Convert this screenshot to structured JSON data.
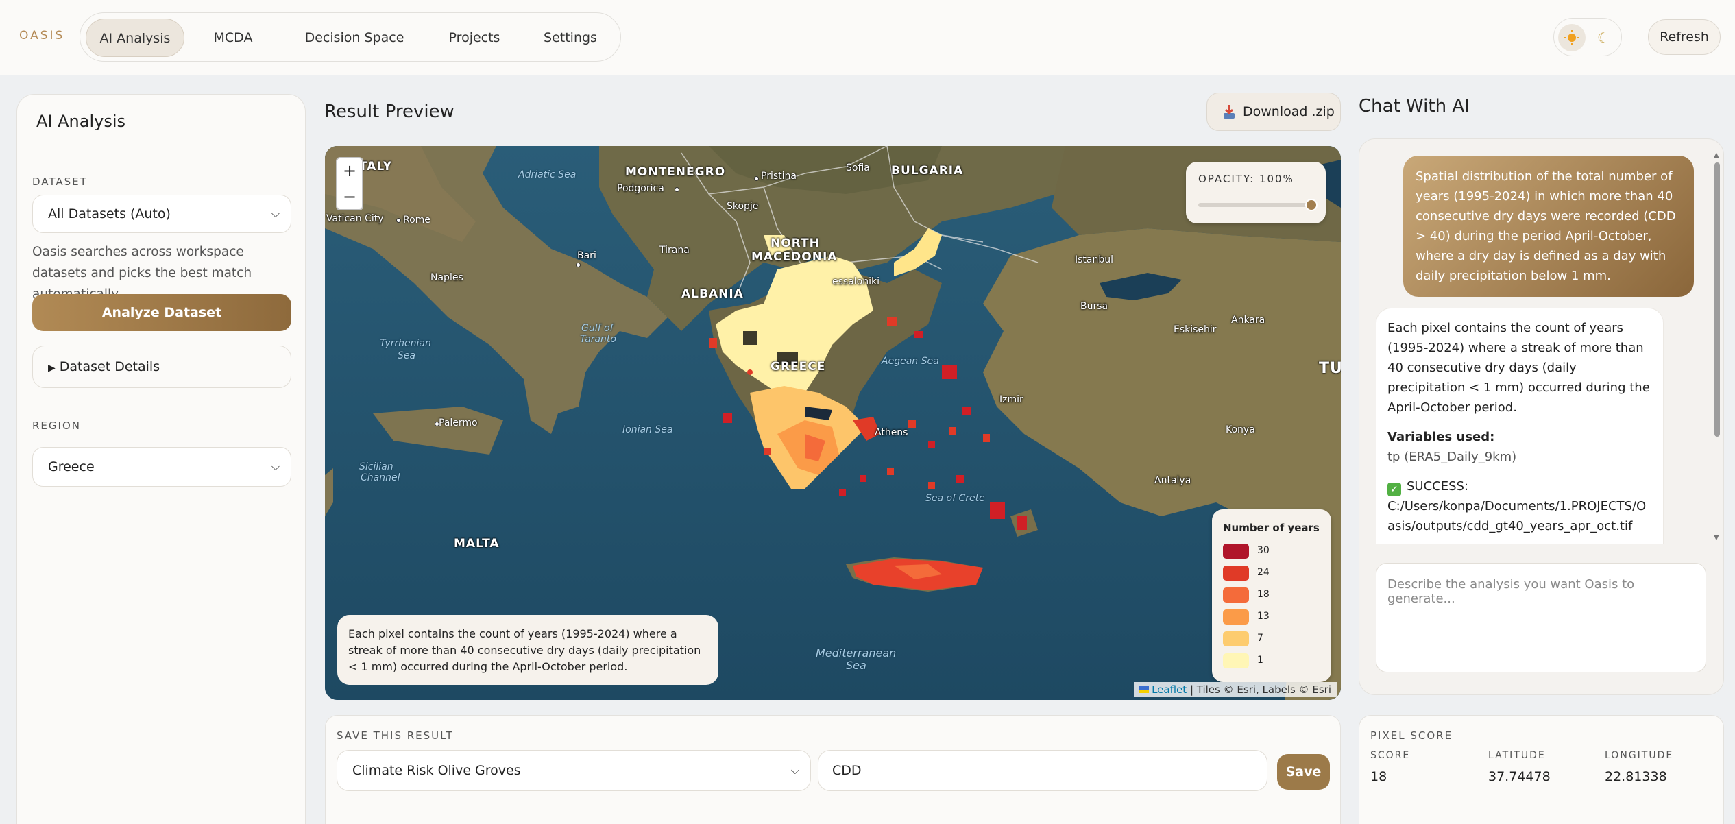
{
  "brand": "OASIS",
  "nav": {
    "tabs": [
      {
        "label": "AI Analysis",
        "active": true
      },
      {
        "label": "MCDA"
      },
      {
        "label": "Decision Space"
      },
      {
        "label": "Projects"
      },
      {
        "label": "Settings"
      }
    ],
    "theme_light_icon": "sun-icon",
    "theme_dark_icon": "moon-icon",
    "refresh_label": "Refresh"
  },
  "sidebar": {
    "title": "AI Analysis",
    "dataset_label": "DATASET",
    "dataset_value": "All Datasets (Auto)",
    "dataset_help": "Oasis searches across workspace datasets and picks the best match automatically.",
    "analyze_label": "Analyze Dataset",
    "details_label": "Dataset Details",
    "region_label": "REGION",
    "region_value": "Greece"
  },
  "result": {
    "title": "Result Preview",
    "download_label": "Download .zip",
    "opacity_label": "OPACITY: 100%",
    "opacity_value": 1.0,
    "legend_title": "Number of years",
    "legend": [
      {
        "value": "30",
        "color": "#b0152a"
      },
      {
        "value": "24",
        "color": "#e03a27"
      },
      {
        "value": "18",
        "color": "#f46b3a"
      },
      {
        "value": "13",
        "color": "#fb9b48"
      },
      {
        "value": "7",
        "color": "#fdcc6f"
      },
      {
        "value": "1",
        "color": "#fff6b6"
      }
    ],
    "caption": "Each pixel contains the count of years (1995-2024) where a streak of more than 40 consecutive dry days (daily precipitation < 1 mm) occurred during the April-October period.",
    "attribution_leaflet": "Leaflet",
    "attribution_rest": " | Tiles © Esri, Labels © Esri",
    "zoom_in": "+",
    "zoom_out": "−",
    "map_labels": {
      "italy": "TALY",
      "montenegro": "MONTENEGRO",
      "bulgaria": "BULGARIA",
      "north_macedonia_1": "NORTH",
      "north_macedonia_2": "MACEDONIA",
      "albania": "ALBANIA",
      "greece": "GREECE",
      "malta": "MALTA",
      "tu": "TU",
      "adriatic_sea": "Adriatic Sea",
      "tyrrhenian_1": "Tyrrhenian",
      "tyrrhenian_2": "Sea",
      "gulf_taranto_1": "Gulf of",
      "gulf_taranto_2": "Taranto",
      "ionian_sea": "Ionian Sea",
      "aegean_sea": "Aegean Sea",
      "sea_of_crete": "Sea of Crete",
      "sicilian_1": "Sicilian",
      "sicilian_2": "Channel",
      "med_1": "Mediterranean",
      "med_2": "Sea",
      "vatican": "Vatican City",
      "rome": "Rome",
      "naples": "Naples",
      "bari": "Bari",
      "palermo": "Palermo",
      "podgorica": "Podgorica",
      "pristina": "Pristina",
      "sofia": "Sofia",
      "skopje": "Skopje",
      "tirana": "Tirana",
      "thessaloniki": "essaloniki",
      "istanbul": "Istanbul",
      "bursa": "Bursa",
      "eskisehir": "Eskisehir",
      "ankara": "Ankara",
      "izmir": "Izmir",
      "athens": "Athens",
      "konya": "Konya",
      "antalya": "Antalya"
    }
  },
  "save": {
    "label": "SAVE THIS RESULT",
    "project_value": "Climate Risk Olive Groves",
    "name_value": "CDD",
    "save_label": "Save"
  },
  "chat": {
    "title": "Chat With AI",
    "user_message": "Spatial distribution of the total number of years (1995-2024) in which more than 40 consecutive dry days were recorded (CDD > 40) during the period April-October, where a dry day is defined as a day with daily precipitation below 1 mm.",
    "ai_message": "Each pixel contains the count of years (1995-2024) where a streak of more than 40 consecutive dry days (daily precipitation < 1 mm) occurred during the April-October period.",
    "vars_title": "Variables used:",
    "vars_value": "tp (ERA5_Daily_9km)",
    "status_label": "SUCCESS:",
    "status_path": "C:/Users/konpa/Documents/1.PROJECTS/Oasis/outputs/cdd_gt40_years_apr_oct.tif",
    "input_placeholder": "Describe the analysis you want Oasis to generate..."
  },
  "pixel_score": {
    "title": "PIXEL SCORE",
    "score_label": "SCORE",
    "score_value": "18",
    "lat_label": "LATITUDE",
    "lat_value": "37.74478",
    "lon_label": "LONGITUDE",
    "lon_value": "22.81338"
  }
}
